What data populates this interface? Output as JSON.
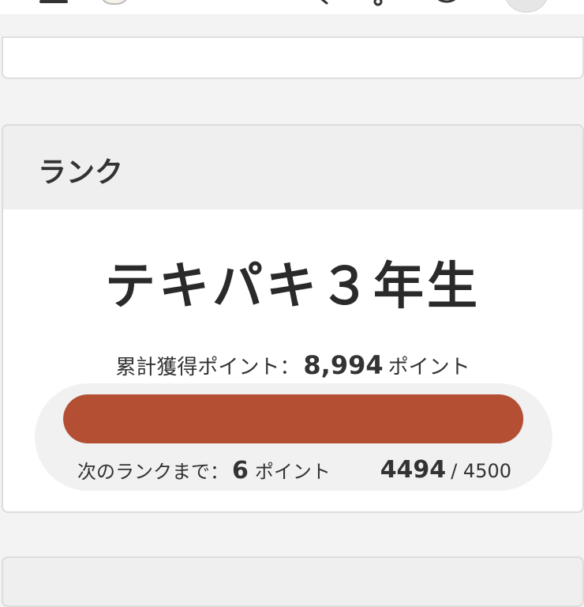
{
  "header": {
    "icons": [
      "menu-icon",
      "logo-icon",
      "search-icon",
      "bell-icon",
      "chat-icon",
      "avatar"
    ]
  },
  "rank_card": {
    "title": "ランク",
    "rank_name": "テキパキ３年生",
    "total_label": "累計獲得ポイント：",
    "total_points": "8,994",
    "points_unit": "ポイント",
    "progress_fraction": 0.9987,
    "progress_color": "#b44f34",
    "next_label": "次のランクまで：",
    "next_points": "6",
    "next_unit": "ポイント",
    "current": "4494",
    "separator": "/",
    "target": "4500"
  }
}
